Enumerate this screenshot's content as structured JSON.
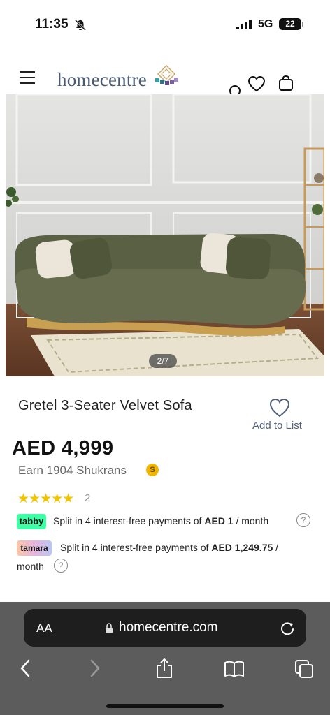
{
  "status_bar": {
    "time": "11:35",
    "network": "5G",
    "battery": "22"
  },
  "header": {
    "logo_text": "homecentre"
  },
  "gallery": {
    "counter": "2/7"
  },
  "product": {
    "title": "Gretel 3-Seater Velvet Sofa",
    "add_to_list": "Add to List",
    "price": "AED 4,999",
    "earn": "Earn 1904 Shukrans",
    "coin_symbol": "S",
    "stars": "★★★★★",
    "rating_count": "2"
  },
  "payments": {
    "tabby": {
      "badge": "tabby",
      "text_prefix": "Split in 4 interest-free payments of",
      "amount": "AED 1",
      "suffix": "/ month",
      "info": "?"
    },
    "tamara": {
      "badge": "tamara",
      "text_prefix": "Split in 4 interest-free payments of",
      "amount": "AED 1,249.75",
      "suffix": "/",
      "line2": "month",
      "info": "?"
    }
  },
  "browser": {
    "aa_label": "AA",
    "url": "homecentre.com"
  },
  "colors": {
    "brand": "#4a5a73",
    "star": "#f5c400",
    "tabby": "#3effa6",
    "link": "#54607a"
  }
}
